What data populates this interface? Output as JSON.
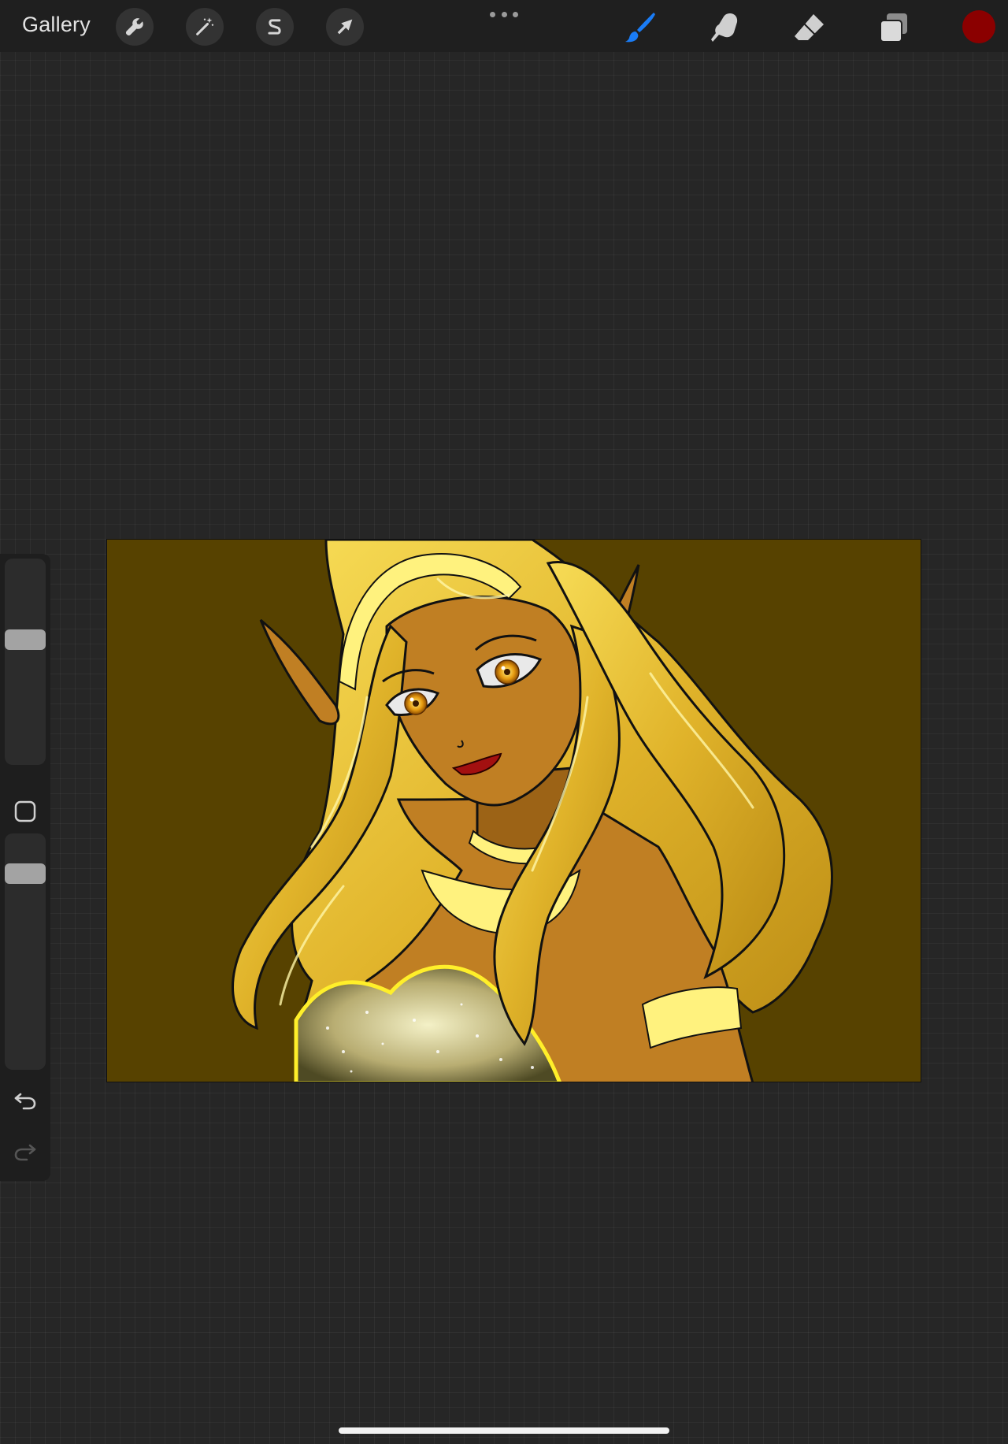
{
  "topbar": {
    "gallery_label": "Gallery",
    "left_tools": [
      {
        "name": "actions",
        "icon": "wrench-icon"
      },
      {
        "name": "adjustments",
        "icon": "magic-wand-icon"
      },
      {
        "name": "selection",
        "icon": "selection-s-icon"
      },
      {
        "name": "transform",
        "icon": "arrow-cursor-icon"
      }
    ],
    "more_icon": "more-dots-icon",
    "right_tools": [
      {
        "name": "brush",
        "icon": "brush-icon",
        "active": true
      },
      {
        "name": "smudge",
        "icon": "smudge-finger-icon",
        "active": false
      },
      {
        "name": "eraser",
        "icon": "eraser-icon",
        "active": false
      },
      {
        "name": "layers",
        "icon": "layers-icon",
        "active": false
      }
    ],
    "current_color": "#8b0000",
    "active_tool_color": "#1a7cf5"
  },
  "sidebar": {
    "brush_size_level": 0.6,
    "opacity_level": 0.95,
    "modify_icon": "square-modify-icon",
    "undo_icon": "undo-icon",
    "redo_icon": "redo-icon"
  },
  "canvas": {
    "background_color": "#574200",
    "artwork": "elf-illustration"
  }
}
